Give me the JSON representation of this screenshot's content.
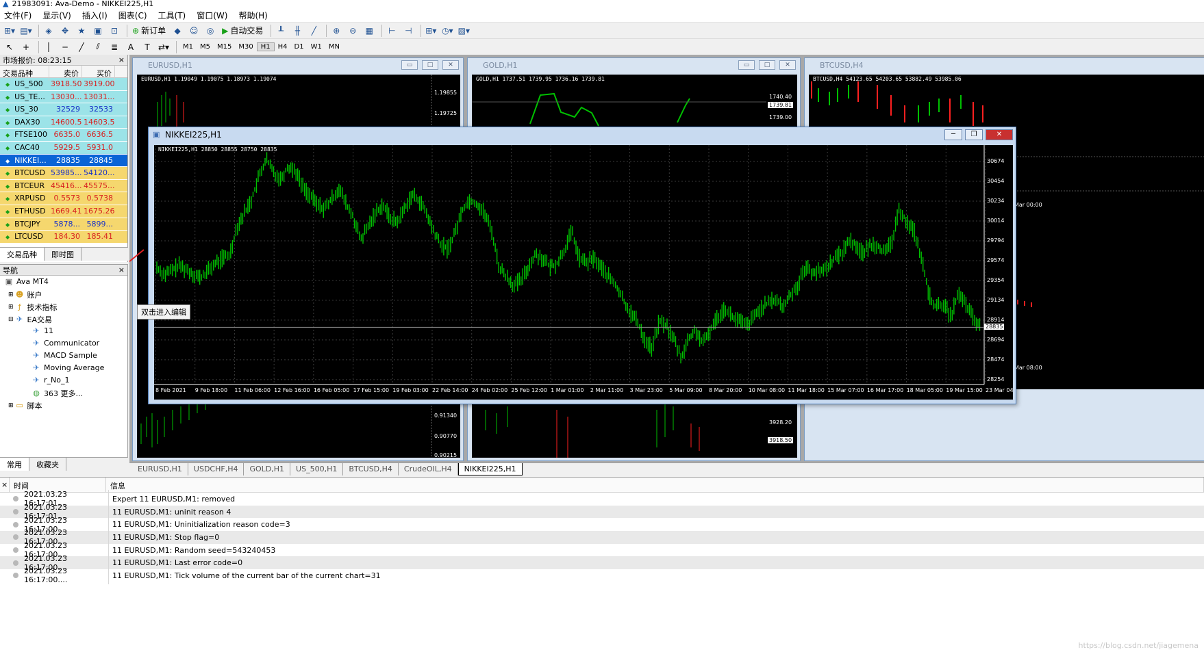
{
  "window": {
    "title": "21983091: Ava-Demo - NIKKEI225,H1"
  },
  "menu": [
    "文件(F)",
    "显示(V)",
    "插入(I)",
    "图表(C)",
    "工具(T)",
    "窗口(W)",
    "帮助(H)"
  ],
  "toolbar": {
    "new_order": "新订单",
    "auto_trade": "自动交易"
  },
  "timeframes": [
    "M1",
    "M5",
    "M15",
    "M30",
    "H1",
    "H4",
    "D1",
    "W1",
    "MN"
  ],
  "active_timeframe": "H1",
  "market_watch": {
    "title": "市场报价: 08:23:15",
    "headers": {
      "symbol": "交易品种",
      "bid": "卖价",
      "ask": "买价"
    },
    "rows": [
      {
        "symbol": "US_500",
        "bid": "3918.50",
        "ask": "3919.00",
        "style": "tint",
        "bid_color": "red",
        "ask_color": "red"
      },
      {
        "symbol": "US_TE...",
        "bid": "13030...",
        "ask": "13031...",
        "style": "tint",
        "bid_color": "red",
        "ask_color": "red"
      },
      {
        "symbol": "US_30",
        "bid": "32529",
        "ask": "32533",
        "style": "tint",
        "bid_color": "blue",
        "ask_color": "blue"
      },
      {
        "symbol": "DAX30",
        "bid": "14600.5",
        "ask": "14603.5",
        "style": "tint",
        "bid_color": "red",
        "ask_color": "red"
      },
      {
        "symbol": "FTSE100",
        "bid": "6635.0",
        "ask": "6636.5",
        "style": "tint",
        "bid_color": "red",
        "ask_color": "red"
      },
      {
        "symbol": "CAC40",
        "bid": "5929.5",
        "ask": "5931.0",
        "style": "tint",
        "bid_color": "red",
        "ask_color": "red"
      },
      {
        "symbol": "NIKKEI...",
        "bid": "28835",
        "ask": "28845",
        "style": "sel",
        "bid_color": "white",
        "ask_color": "white"
      },
      {
        "symbol": "BTCUSD",
        "bid": "53985...",
        "ask": "54120...",
        "style": "yellow",
        "bid_color": "blue",
        "ask_color": "blue"
      },
      {
        "symbol": "BTCEUR",
        "bid": "45416...",
        "ask": "45575...",
        "style": "yellow",
        "bid_color": "red",
        "ask_color": "red"
      },
      {
        "symbol": "XRPUSD",
        "bid": "0.5573",
        "ask": "0.5738",
        "style": "yellow",
        "bid_color": "red",
        "ask_color": "red"
      },
      {
        "symbol": "ETHUSD",
        "bid": "1669.41",
        "ask": "1675.26",
        "style": "yellow",
        "bid_color": "red",
        "ask_color": "red"
      },
      {
        "symbol": "BTCJPY",
        "bid": "5878...",
        "ask": "5899...",
        "style": "yellow",
        "bid_color": "blue",
        "ask_color": "blue"
      },
      {
        "symbol": "LTCUSD",
        "bid": "184.30",
        "ask": "185.41",
        "style": "yellow",
        "bid_color": "red",
        "ask_color": "red"
      }
    ],
    "tabs": [
      "交易品种",
      "即时图"
    ]
  },
  "navigator": {
    "title": "导航",
    "root": "Ava MT4",
    "items": [
      {
        "label": "账户",
        "icon": "accounts-icon"
      },
      {
        "label": "技术指标",
        "icon": "indicators-icon"
      },
      {
        "label": "EA交易",
        "icon": "expert-advisors-icon"
      },
      {
        "label": "11",
        "icon": "ea-icon"
      },
      {
        "label": "Communicator",
        "icon": "ea-icon"
      },
      {
        "label": "MACD Sample",
        "icon": "ea-icon"
      },
      {
        "label": "Moving Average",
        "icon": "ea-icon"
      },
      {
        "label": "r_No_1",
        "icon": "ea-icon"
      },
      {
        "label": "363 更多...",
        "icon": "globe-icon"
      },
      {
        "label": "脚本",
        "icon": "scripts-icon"
      }
    ],
    "tabs": [
      "常用",
      "收藏夹"
    ]
  },
  "tooltip": "双击进入编辑",
  "charts": {
    "eurusd": {
      "title": "EURUSD,H1",
      "header": "EURUSD,H1  1.19049 1.19075 1.18973 1.19074",
      "prices": [
        "1.19855",
        "1.19725"
      ],
      "bottom_prices": [
        "0.91340",
        "0.90770",
        "0.90215"
      ]
    },
    "gold": {
      "title": "GOLD,H1",
      "header": "GOLD,H1  1737.51 1739.95 1736.16 1739.81",
      "prices": [
        "1740.40",
        "1739.81",
        "1739.00"
      ],
      "bottom_prices": [
        "3928.20",
        "3918.50"
      ]
    },
    "btcusd": {
      "title": "BTCUSD,H4",
      "header": "BTCUSD,H4  54123.65 54203.65 53882.49 53985.06",
      "time_labels": [
        "Mar 00:00",
        "Mar 08:00"
      ]
    },
    "nikkei": {
      "title": "NIKKEI225,H1",
      "header": "NIKKEI225,H1  28850 28855 28750 28835",
      "current_price": "28835",
      "price_labels": [
        "30674",
        "30454",
        "30234",
        "30014",
        "29794",
        "29574",
        "29354",
        "29134",
        "28914",
        "28694",
        "28474",
        "28254"
      ],
      "time_labels": [
        "8 Feb 2021",
        "9 Feb 18:00",
        "11 Feb 06:00",
        "12 Feb 16:00",
        "16 Feb 05:00",
        "17 Feb 15:00",
        "19 Feb 03:00",
        "22 Feb 14:00",
        "24 Feb 02:00",
        "25 Feb 12:00",
        "1 Mar 01:00",
        "2 Mar 11:00",
        "3 Mar 23:00",
        "5 Mar 09:00",
        "8 Mar 20:00",
        "10 Mar 08:00",
        "11 Mar 18:00",
        "15 Mar 07:00",
        "16 Mar 17:00",
        "18 Mar 05:00",
        "19 Mar 15:00",
        "23 Mar 04:00"
      ],
      "close_series": [
        29500,
        29420,
        29460,
        29520,
        29480,
        29430,
        29380,
        29460,
        29540,
        29600,
        29640,
        29950,
        30100,
        30250,
        30500,
        30700,
        30560,
        30480,
        30620,
        30580,
        30400,
        30300,
        30200,
        30150,
        30250,
        30380,
        30200,
        30050,
        29800,
        29950,
        30100,
        30200,
        30050,
        30000,
        30150,
        30300,
        30250,
        30100,
        29900,
        29750,
        29700,
        29900,
        30150,
        30250,
        30200,
        30100,
        29900,
        29500,
        29400,
        29300,
        29350,
        29500,
        29650,
        29600,
        29500,
        29550,
        29700,
        29900,
        29600,
        29550,
        29600,
        29500,
        29400,
        29300,
        29150,
        29000,
        28900,
        28700,
        28600,
        28900,
        28850,
        28700,
        28500,
        28700,
        28800,
        28650,
        28800,
        28950,
        29050,
        28950,
        28900,
        28850,
        28950,
        29050,
        29100,
        29150,
        29050,
        29200,
        29300,
        29500,
        29450,
        29450,
        29500,
        29600,
        29650,
        29800,
        29750,
        29650,
        29750,
        29750,
        29650,
        29800,
        30150,
        30000,
        29900,
        29600,
        29200,
        29050,
        29100,
        28950,
        29200,
        29100,
        28950,
        28835
      ]
    }
  },
  "chart_tabs": [
    "EURUSD,H1",
    "USDCHF,H4",
    "GOLD,H1",
    "US_500,H1",
    "BTCUSD,H4",
    "CrudeOIL,H4",
    "NIKKEI225,H1"
  ],
  "active_chart_tab": "NIKKEI225,H1",
  "terminal": {
    "headers": {
      "time": "时间",
      "message": "信息"
    },
    "rows": [
      {
        "time": "2021.03.23 16:17:01....",
        "msg": "Expert 11 EURUSD,M1: removed"
      },
      {
        "time": "2021.03.23 16:17:01....",
        "msg": "11 EURUSD,M1: uninit reason 4"
      },
      {
        "time": "2021.03.23 16:17:00....",
        "msg": "11 EURUSD,M1: Uninitialization reason code=3"
      },
      {
        "time": "2021.03.23 16:17:00....",
        "msg": "11 EURUSD,M1: Stop flag=0"
      },
      {
        "time": "2021.03.23 16:17:00....",
        "msg": "11 EURUSD,M1: Random seed=543240453"
      },
      {
        "time": "2021.03.23 16:17:00....",
        "msg": "11 EURUSD,M1: Last error code=0"
      },
      {
        "time": "2021.03.23 16:17:00....",
        "msg": "11 EURUSD,M1: Tick volume of the current bar of the current chart=31"
      }
    ]
  },
  "watermark": "https://blog.csdn.net/jiagemena",
  "colors": {
    "candle": "#00c000",
    "bear": "#ff2020",
    "selection": "#0a64d6",
    "tint": "#9ce3e8",
    "yellow": "#f5d76e"
  }
}
